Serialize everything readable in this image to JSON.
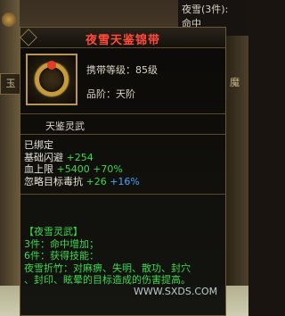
{
  "background": {
    "left_tab": "玉",
    "right_tab": "魔",
    "top_right": [
      "夜雪(3件):",
      "命中"
    ],
    "watermark": "WWW.SXDS.COM"
  },
  "tooltip": {
    "title": "夜雪天鉴锦带",
    "carry_level": "携带等级：85级",
    "rank": "品阶：天阶",
    "section": "天鉴灵武",
    "bound": "已绑定",
    "stats": [
      {
        "name": "基础闪避",
        "base": "+254",
        "extra": "",
        "pct": ""
      },
      {
        "name": "血上限",
        "base": "",
        "extra": "+5400",
        "pct": "+70%"
      },
      {
        "name": "忽略目标毒抗",
        "base": "+26",
        "extra": "",
        "pct": "+16%"
      }
    ],
    "set_title": "【夜雪灵武】",
    "set_lines": [
      "3件：命中增加；",
      "6件：获得技能：",
      "夜雪折竹：对麻痹、失明、散功、封穴",
      "、封印、眩晕的目标造成的伤害提高。"
    ]
  },
  "colors": {
    "title": "#ff4b3a",
    "green": "#39d84a",
    "blue": "#4aa3ff",
    "text": "#d9d3c2"
  }
}
